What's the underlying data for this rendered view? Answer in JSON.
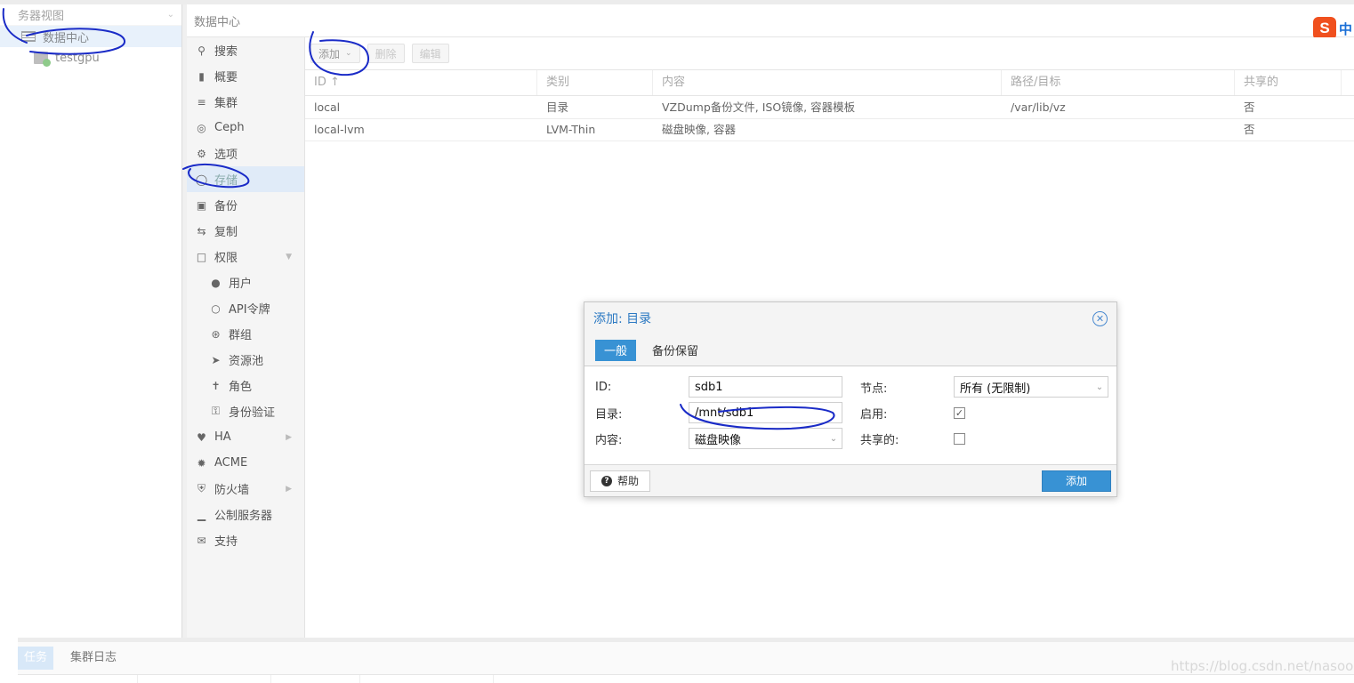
{
  "tree": {
    "header": "务器视图",
    "nodes": [
      {
        "label": "数据中心"
      },
      {
        "label": "testgpu"
      }
    ]
  },
  "content": {
    "title": "数据中心"
  },
  "nav": {
    "items": [
      {
        "icon": "search-icon",
        "label": "搜索"
      },
      {
        "icon": "book-icon",
        "label": "概要"
      },
      {
        "icon": "server-stack-icon",
        "label": "集群"
      },
      {
        "icon": "ceph-icon",
        "label": "Ceph"
      },
      {
        "icon": "gear-icon",
        "label": "选项"
      },
      {
        "icon": "database-icon",
        "label": "存储"
      },
      {
        "icon": "floppy-icon",
        "label": "备份"
      },
      {
        "icon": "retweet-icon",
        "label": "复制"
      },
      {
        "icon": "unlock-icon",
        "label": "权限"
      },
      {
        "icon": "user-icon",
        "label": "用户"
      },
      {
        "icon": "user-outline-icon",
        "label": "API令牌"
      },
      {
        "icon": "users-icon",
        "label": "群组"
      },
      {
        "icon": "tags-icon",
        "label": "资源池"
      },
      {
        "icon": "male-icon",
        "label": "角色"
      },
      {
        "icon": "key-icon",
        "label": "身份验证"
      },
      {
        "icon": "heartbeat-icon",
        "label": "HA"
      },
      {
        "icon": "certificate-icon",
        "label": "ACME"
      },
      {
        "icon": "shield-icon",
        "label": "防火墙"
      },
      {
        "icon": "bar-chart-icon",
        "label": "公制服务器"
      },
      {
        "icon": "comments-icon",
        "label": "支持"
      }
    ]
  },
  "toolbar": {
    "add": "添加",
    "remove": "删除",
    "edit": "编辑"
  },
  "grid": {
    "columns": [
      "ID ↑",
      "类别",
      "内容",
      "路径/目标",
      "共享的"
    ],
    "rows": [
      [
        "local",
        "目录",
        "VZDump备份文件, ISO镜像, 容器模板",
        "/var/lib/vz",
        "否"
      ],
      [
        "local-lvm",
        "LVM-Thin",
        "磁盘映像, 容器",
        "",
        "否"
      ]
    ]
  },
  "dialog": {
    "title": "添加: 目录",
    "tabs": [
      "一般",
      "备份保留"
    ],
    "fields": {
      "id_label": "ID:",
      "id_value": "sdb1",
      "dir_label": "目录:",
      "dir_value": "/mnt/sdb1",
      "content_label": "内容:",
      "content_value": "磁盘映像",
      "node_label": "节点:",
      "node_value": "所有 (无限制)",
      "enable_label": "启用:",
      "enable_checked": true,
      "shared_label": "共享的:",
      "shared_checked": false
    },
    "help": "帮助",
    "submit": "添加"
  },
  "bottom": {
    "tabs": [
      "任务",
      "集群日志"
    ]
  },
  "watermark": "https://blog.csdn.net/nasooo",
  "ime": {
    "s": "S",
    "zh": "中"
  },
  "colors": {
    "accent": "#3892d4",
    "annotation": "#1a2bc7"
  }
}
